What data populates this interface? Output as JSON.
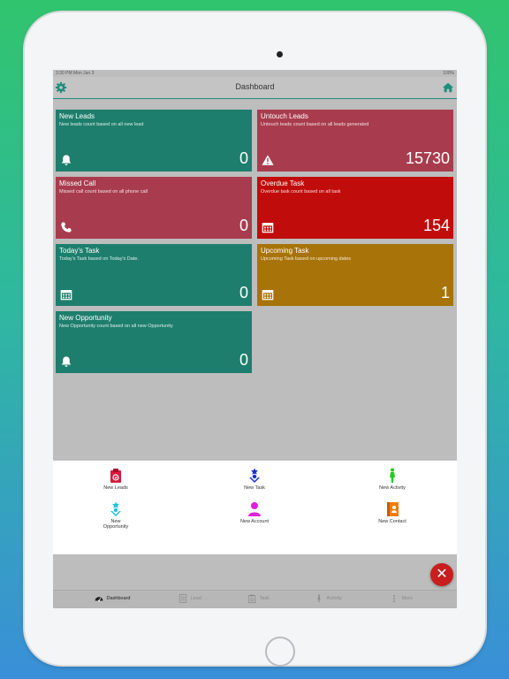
{
  "statusbar": {
    "time": "3:30 PM   Mon Jun 3",
    "battery": "100%"
  },
  "header": {
    "title": "Dashboard"
  },
  "cards": [
    {
      "title": "New Leads",
      "subtitle": "New leads count based on all new lead",
      "value": "0",
      "icon": "bell-icon",
      "color": "#1e7e6d"
    },
    {
      "title": "Untouch Leads",
      "subtitle": "Untouch leads count based on all leads generated",
      "value": "15730",
      "icon": "warning-icon",
      "color": "#a83c4e"
    },
    {
      "title": "Missed Call",
      "subtitle": "Missed call count based on all phone call",
      "value": "0",
      "icon": "phone-icon",
      "color": "#a83c4e"
    },
    {
      "title": "Overdue Task",
      "subtitle": "Overdue task count based on all task",
      "value": "154",
      "icon": "calendar-icon",
      "color": "#c10c0c"
    },
    {
      "title": "Today's Task",
      "subtitle": "Today's Task based on Today's Date.",
      "value": "0",
      "icon": "calendar-icon",
      "color": "#1e7e6d"
    },
    {
      "title": "Upcoming Task",
      "subtitle": "Upcoming Task based on upcoming dates",
      "value": "1",
      "icon": "calendar-icon",
      "color": "#a87308"
    },
    {
      "title": "New Opportunity",
      "subtitle": "New Opportunity count based on all new Opportunity",
      "value": "0",
      "icon": "bell-icon",
      "color": "#1e7e6d"
    }
  ],
  "quick_actions": [
    {
      "label": "New Leads",
      "icon": "clipboard-icon",
      "color": "#d81b3c"
    },
    {
      "label": "New Task",
      "icon": "task-person-icon",
      "color": "#1a2bd8"
    },
    {
      "label": "New Activity",
      "icon": "activity-person-icon",
      "color": "#22cc22"
    },
    {
      "label": "New Opportunity",
      "icon": "opportunity-person-icon",
      "color": "#1cc6d8"
    },
    {
      "label": "New Account",
      "icon": "account-person-icon",
      "color": "#e020d8"
    },
    {
      "label": "New Contact",
      "icon": "contact-book-icon",
      "color": "#f07c10"
    }
  ],
  "tabs": [
    {
      "label": "Dashboard",
      "icon": "speedometer-icon",
      "active": true
    },
    {
      "label": "Lead",
      "icon": "document-icon",
      "active": false
    },
    {
      "label": "Task",
      "icon": "clipboard-icon",
      "active": false
    },
    {
      "label": "Activity",
      "icon": "walking-person-icon",
      "active": false
    },
    {
      "label": "More",
      "icon": "more-dots-icon",
      "active": false
    }
  ],
  "fab": {
    "label": "✕"
  }
}
